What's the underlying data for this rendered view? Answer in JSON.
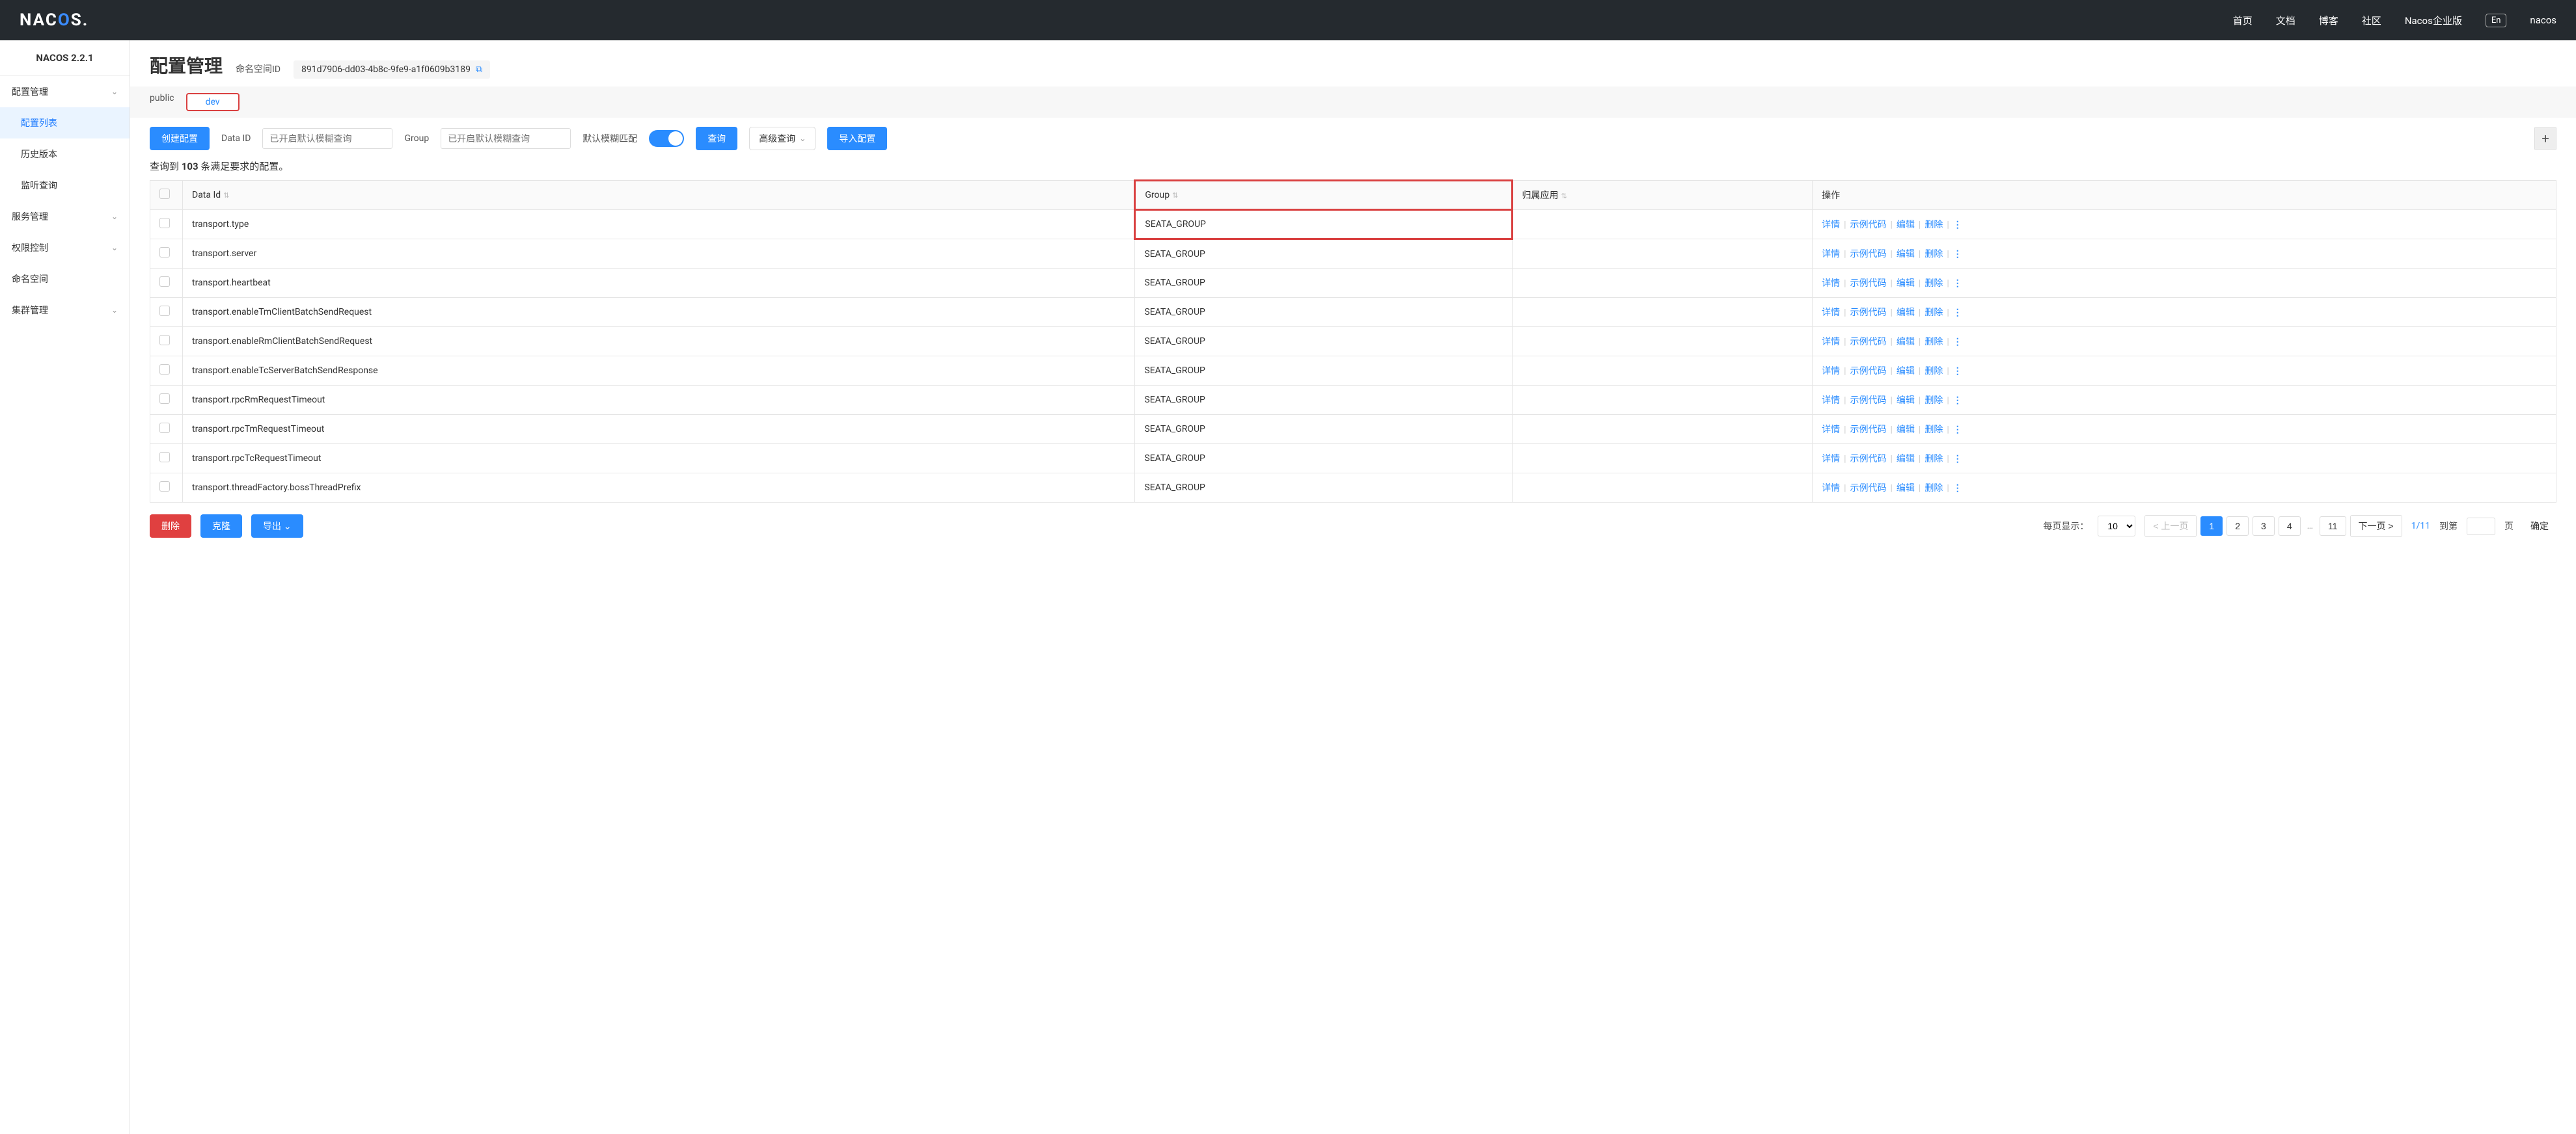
{
  "topbar": {
    "logo_left": "NAC",
    "logo_o": "O",
    "logo_right": "S.",
    "links": [
      "首页",
      "文档",
      "博客",
      "社区",
      "Nacos企业版"
    ],
    "lang": "En",
    "user": "nacos"
  },
  "sidebar": {
    "version": "NACOS 2.2.1",
    "groups": [
      {
        "label": "配置管理",
        "expanded": true,
        "items": [
          {
            "label": "配置列表",
            "active": true
          },
          {
            "label": "历史版本",
            "active": false
          },
          {
            "label": "监听查询",
            "active": false
          }
        ]
      },
      {
        "label": "服务管理",
        "expanded": false
      },
      {
        "label": "权限控制",
        "expanded": false
      },
      {
        "label": "命名空间",
        "expanded": false,
        "nochev": true
      },
      {
        "label": "集群管理",
        "expanded": false
      }
    ]
  },
  "page": {
    "title": "配置管理",
    "ns_label": "命名空间ID",
    "ns_id": "891d7906-dd03-4b8c-9fe9-a1f0609b3189"
  },
  "tabs": [
    {
      "label": "public",
      "active": false
    },
    {
      "label": "dev",
      "active": true
    }
  ],
  "toolbar": {
    "create": "创建配置",
    "dataid_label": "Data ID",
    "dataid_ph": "已开启默认模糊查询",
    "group_label": "Group",
    "group_ph": "已开启默认模糊查询",
    "fuzzy_label": "默认模糊匹配",
    "query": "查询",
    "adv": "高级查询",
    "import": "导入配置"
  },
  "result": {
    "prefix": "查询到 ",
    "count": "103",
    "suffix": " 条满足要求的配置。"
  },
  "columns": {
    "dataid": "Data Id",
    "group": "Group",
    "app": "归属应用",
    "action": "操作"
  },
  "rows": [
    {
      "dataid": "transport.type",
      "group": "SEATA_GROUP",
      "app": ""
    },
    {
      "dataid": "transport.server",
      "group": "SEATA_GROUP",
      "app": ""
    },
    {
      "dataid": "transport.heartbeat",
      "group": "SEATA_GROUP",
      "app": ""
    },
    {
      "dataid": "transport.enableTmClientBatchSendRequest",
      "group": "SEATA_GROUP",
      "app": ""
    },
    {
      "dataid": "transport.enableRmClientBatchSendRequest",
      "group": "SEATA_GROUP",
      "app": ""
    },
    {
      "dataid": "transport.enableTcServerBatchSendResponse",
      "group": "SEATA_GROUP",
      "app": ""
    },
    {
      "dataid": "transport.rpcRmRequestTimeout",
      "group": "SEATA_GROUP",
      "app": ""
    },
    {
      "dataid": "transport.rpcTmRequestTimeout",
      "group": "SEATA_GROUP",
      "app": ""
    },
    {
      "dataid": "transport.rpcTcRequestTimeout",
      "group": "SEATA_GROUP",
      "app": ""
    },
    {
      "dataid": "transport.threadFactory.bossThreadPrefix",
      "group": "SEATA_GROUP",
      "app": ""
    }
  ],
  "row_actions": {
    "detail": "详情",
    "example": "示例代码",
    "edit": "编辑",
    "delete": "删除"
  },
  "footer": {
    "delete": "删除",
    "clone": "克隆",
    "export": "导出",
    "pagesize_label": "每页显示：",
    "pagesize": "10",
    "prev": "上一页",
    "next": "下一页",
    "pages": [
      "1",
      "2",
      "3",
      "4",
      "…",
      "11"
    ],
    "page_info": "1/11",
    "jump_pre": "到第",
    "jump_suf": "页",
    "confirm": "确定"
  }
}
